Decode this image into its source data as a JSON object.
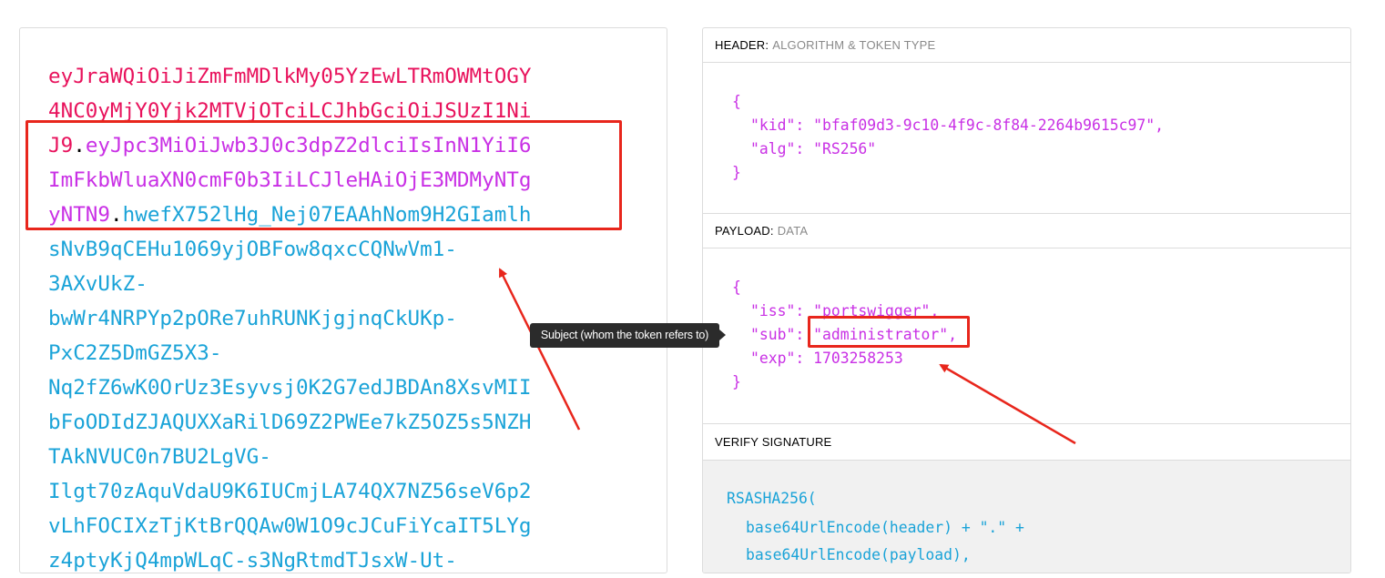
{
  "encoded": {
    "lines": [
      {
        "segments": [
          {
            "text": "eyJraWQiOiJiZmFmMDlkMy05YzEwLTRmOWMtOGY",
            "kind": "header"
          }
        ]
      },
      {
        "segments": [
          {
            "text": "4NC0yMjY0Yjk2MTVjOTciLCJhbGciOiJSUzI1Ni",
            "kind": "header"
          }
        ]
      },
      {
        "segments": [
          {
            "text": "J9",
            "kind": "header"
          },
          {
            "text": ".",
            "kind": "dot"
          },
          {
            "text": "eyJpc3MiOiJwb3J0c3dpZ2dlciIsInN1YiI6",
            "kind": "payload"
          }
        ]
      },
      {
        "segments": [
          {
            "text": "ImFkbWluaXN0cmF0b3IiLCJleHAiOjE3MDMyNTg",
            "kind": "payload"
          }
        ]
      },
      {
        "segments": [
          {
            "text": "yNTN9",
            "kind": "payload"
          },
          {
            "text": ".",
            "kind": "dot"
          },
          {
            "text": "hwefX752lHg_Nej07EAAhNom9H2GIamlh",
            "kind": "sig"
          }
        ]
      },
      {
        "segments": [
          {
            "text": "sNvB9qCEHu1069yjOBFow8qxcCQNwVm1-",
            "kind": "sig"
          }
        ]
      },
      {
        "segments": [
          {
            "text": "3AXvUkZ-",
            "kind": "sig"
          }
        ]
      },
      {
        "segments": [
          {
            "text": "bwWr4NRPYp2pORe7uhRUNKjgjnqCkUKp-",
            "kind": "sig"
          }
        ]
      },
      {
        "segments": [
          {
            "text": "PxC2Z5DmGZ5X3-",
            "kind": "sig"
          }
        ]
      },
      {
        "segments": [
          {
            "text": "Nq2fZ6wK0OrUz3Esyvsj0K2G7edJBDAn8XsvMII",
            "kind": "sig"
          }
        ]
      },
      {
        "segments": [
          {
            "text": "bFoODIdZJAQUXXaRilD69Z2PWEe7kZ5OZ5s5NZH",
            "kind": "sig"
          }
        ]
      },
      {
        "segments": [
          {
            "text": "TAkNVUC0n7BU2LgVG-",
            "kind": "sig"
          }
        ]
      },
      {
        "segments": [
          {
            "text": "Ilgt70zAquVdaU9K6IUCmjLA74QX7NZ56seV6p2",
            "kind": "sig"
          }
        ]
      },
      {
        "segments": [
          {
            "text": "vLhFOCIXzTjKtBrQQAw0W1O9cJCuFiYcaIT5LYg",
            "kind": "sig"
          }
        ]
      },
      {
        "segments": [
          {
            "text": "z4ptyKjQ4mpWLqC-s3NgRtmdTJsxW-Ut-",
            "kind": "sig"
          }
        ]
      }
    ]
  },
  "decoded": {
    "header": {
      "title": "HEADER:",
      "subtitle": "ALGORITHM & TOKEN TYPE",
      "open": "{",
      "close": "}",
      "kid_key": "\"kid\"",
      "kid_value": "\"bfaf09d3-9c10-4f9c-8f84-2264b9615c97\"",
      "alg_key": "\"alg\"",
      "alg_value": "\"RS256\""
    },
    "payload": {
      "title": "PAYLOAD:",
      "subtitle": "DATA",
      "open": "{",
      "close": "}",
      "iss_key": "\"iss\"",
      "iss_value": "\"portswigger\"",
      "sub_key": "\"sub\"",
      "sub_value": "\"administrator\"",
      "exp_key": "\"exp\"",
      "exp_value": "1703258253"
    },
    "verify": {
      "title": "VERIFY SIGNATURE",
      "line1": "RSASHA256(",
      "line2": "base64UrlEncode(header) + \".\" +",
      "line3": "base64UrlEncode(payload),"
    }
  },
  "tooltip": {
    "text": "Subject (whom the token refers to)"
  },
  "colors": {
    "header": "#e8125c",
    "payload": "#c930e5",
    "signature": "#1aa3d8",
    "annotation": "#e8261c"
  }
}
